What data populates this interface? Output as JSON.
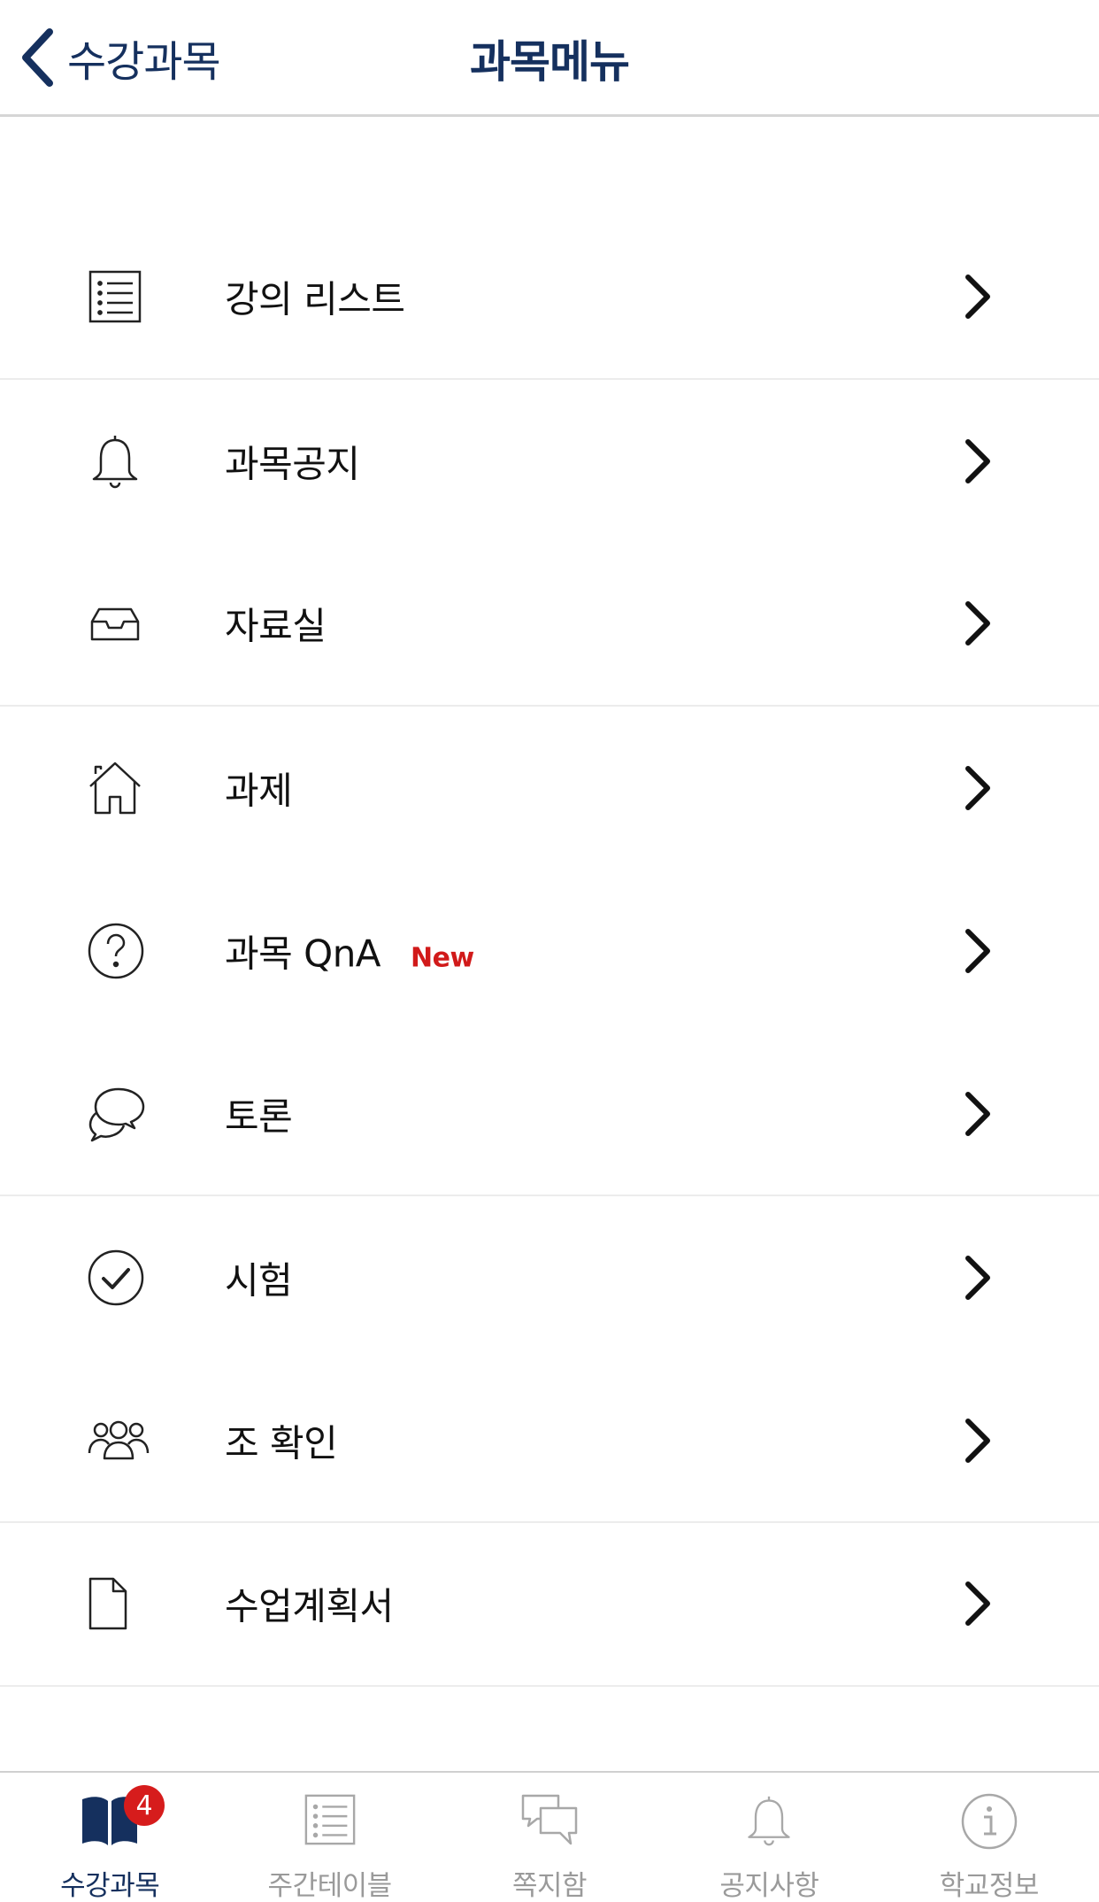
{
  "header": {
    "back_label": "수강과목",
    "title": "과목메뉴"
  },
  "menu": [
    {
      "label": "강의 리스트",
      "icon": "list-icon"
    },
    {
      "label": "과목공지",
      "icon": "bell-icon"
    },
    {
      "label": "자료실",
      "icon": "inbox-icon"
    },
    {
      "label": "과제",
      "icon": "house-icon"
    },
    {
      "label": "과목 QnA",
      "icon": "question-icon",
      "badge": "New"
    },
    {
      "label": "토론",
      "icon": "chat-bubbles-icon"
    },
    {
      "label": "시험",
      "icon": "check-circle-icon"
    },
    {
      "label": "조 확인",
      "icon": "group-icon"
    },
    {
      "label": "수업계획서",
      "icon": "document-icon"
    }
  ],
  "tabbar": {
    "items": [
      {
        "label": "수강과목",
        "icon": "book-icon",
        "active": true,
        "badge_count": "4"
      },
      {
        "label": "주간테이블",
        "icon": "list-icon",
        "active": false
      },
      {
        "label": "쪽지함",
        "icon": "messages-icon",
        "active": false
      },
      {
        "label": "공지사항",
        "icon": "bell-icon",
        "active": false
      },
      {
        "label": "학교정보",
        "icon": "info-icon",
        "active": false
      }
    ]
  },
  "colors": {
    "brand": "#15305e",
    "new_badge": "#d11a1a",
    "count_badge": "#d61c1c",
    "inactive_tab": "#9a9a9a"
  }
}
